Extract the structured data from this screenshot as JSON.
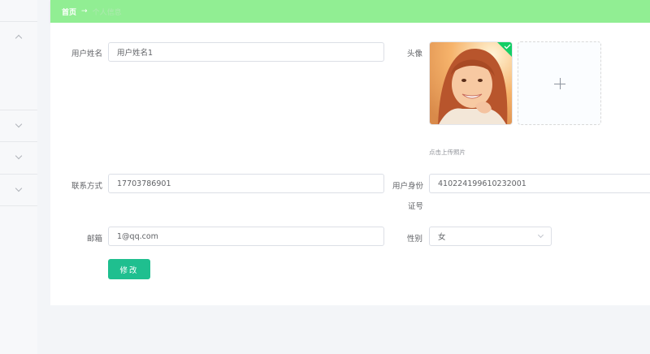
{
  "breadcrumb": {
    "home": "首页",
    "separator": "→",
    "current": "个人信息"
  },
  "sidebar": {
    "icons": [
      "chevron-up-icon",
      "chevron-down-icon",
      "chevron-down-icon",
      "chevron-down-icon"
    ]
  },
  "form": {
    "name_label": "用户姓名",
    "name_value": "用户姓名1",
    "avatar_label": "头像",
    "upload_tip": "点击上传照片",
    "phone_label": "联系方式",
    "phone_value": "17703786901",
    "id_label_line1": "用户身份",
    "id_label_line2": "证号",
    "id_value": "410224199610232001",
    "email_label": "邮箱",
    "email_value": "1@qq.com",
    "gender_label": "性别",
    "gender_value": "女",
    "submit_label": "修改"
  },
  "colors": {
    "topbar": "#91ee93",
    "primary_button": "#1fbf8f",
    "upload_success": "#13ce66"
  }
}
